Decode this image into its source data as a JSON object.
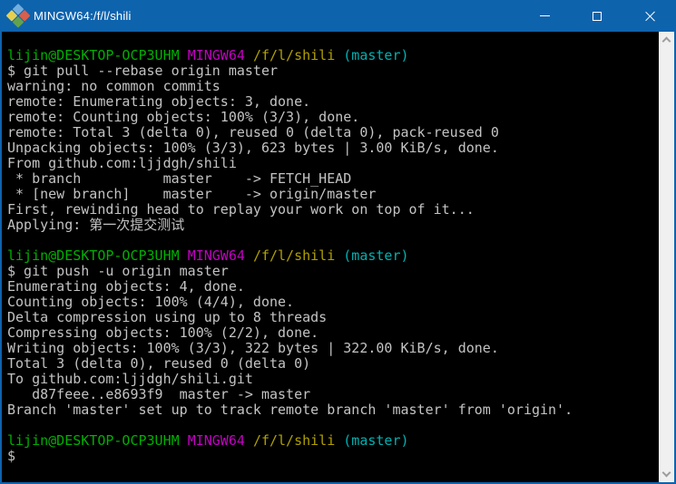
{
  "colors": {
    "titlebar_bg": "#0e63ad",
    "terminal_bg": "#000000",
    "fg": "#c3c3c3",
    "green": "#00b000",
    "magenta": "#c400c4",
    "yellow": "#b0a000",
    "cyan": "#00b2b2",
    "icon_blue": "#74aede",
    "icon_red": "#d75f4c",
    "icon_yellow": "#e6d04f",
    "icon_green": "#63a24c"
  },
  "titlebar": {
    "title": "MINGW64:/f/l/shili",
    "controls": [
      "minimize",
      "maximize",
      "close"
    ]
  },
  "terminal": {
    "lines": [
      {
        "segments": [
          {
            "color": "green",
            "text": "lijin@DESKTOP-OCP3UHM "
          },
          {
            "color": "magenta",
            "text": "MINGW64 "
          },
          {
            "color": "yellow",
            "text": "/f/l/shili "
          },
          {
            "color": "cyan",
            "text": "(master)"
          }
        ]
      },
      {
        "segments": [
          {
            "color": "fg",
            "text": "$ git pull --rebase origin master"
          }
        ]
      },
      {
        "segments": [
          {
            "color": "fg",
            "text": "warning: no common commits"
          }
        ]
      },
      {
        "segments": [
          {
            "color": "fg",
            "text": "remote: Enumerating objects: 3, done."
          }
        ]
      },
      {
        "segments": [
          {
            "color": "fg",
            "text": "remote: Counting objects: 100% (3/3), done."
          }
        ]
      },
      {
        "segments": [
          {
            "color": "fg",
            "text": "remote: Total 3 (delta 0), reused 0 (delta 0), pack-reused 0"
          }
        ]
      },
      {
        "segments": [
          {
            "color": "fg",
            "text": "Unpacking objects: 100% (3/3), 623 bytes | 3.00 KiB/s, done."
          }
        ]
      },
      {
        "segments": [
          {
            "color": "fg",
            "text": "From github.com:ljjdgh/shili"
          }
        ]
      },
      {
        "segments": [
          {
            "color": "fg",
            "text": " * branch          master    -> FETCH_HEAD"
          }
        ]
      },
      {
        "segments": [
          {
            "color": "fg",
            "text": " * [new branch]    master    -> origin/master"
          }
        ]
      },
      {
        "segments": [
          {
            "color": "fg",
            "text": "First, rewinding head to replay your work on top of it..."
          }
        ]
      },
      {
        "segments": [
          {
            "color": "fg",
            "text": "Applying: 第一次提交测试"
          }
        ]
      },
      {
        "segments": []
      },
      {
        "segments": [
          {
            "color": "green",
            "text": "lijin@DESKTOP-OCP3UHM "
          },
          {
            "color": "magenta",
            "text": "MINGW64 "
          },
          {
            "color": "yellow",
            "text": "/f/l/shili "
          },
          {
            "color": "cyan",
            "text": "(master)"
          }
        ]
      },
      {
        "segments": [
          {
            "color": "fg",
            "text": "$ git push -u origin master"
          }
        ]
      },
      {
        "segments": [
          {
            "color": "fg",
            "text": "Enumerating objects: 4, done."
          }
        ]
      },
      {
        "segments": [
          {
            "color": "fg",
            "text": "Counting objects: 100% (4/4), done."
          }
        ]
      },
      {
        "segments": [
          {
            "color": "fg",
            "text": "Delta compression using up to 8 threads"
          }
        ]
      },
      {
        "segments": [
          {
            "color": "fg",
            "text": "Compressing objects: 100% (2/2), done."
          }
        ]
      },
      {
        "segments": [
          {
            "color": "fg",
            "text": "Writing objects: 100% (3/3), 322 bytes | 322.00 KiB/s, done."
          }
        ]
      },
      {
        "segments": [
          {
            "color": "fg",
            "text": "Total 3 (delta 0), reused 0 (delta 0)"
          }
        ]
      },
      {
        "segments": [
          {
            "color": "fg",
            "text": "To github.com:ljjdgh/shili.git"
          }
        ]
      },
      {
        "segments": [
          {
            "color": "fg",
            "text": "   d87feee..e8693f9  master -> master"
          }
        ]
      },
      {
        "segments": [
          {
            "color": "fg",
            "text": "Branch 'master' set up to track remote branch 'master' from 'origin'."
          }
        ]
      },
      {
        "segments": []
      },
      {
        "segments": [
          {
            "color": "green",
            "text": "lijin@DESKTOP-OCP3UHM "
          },
          {
            "color": "magenta",
            "text": "MINGW64 "
          },
          {
            "color": "yellow",
            "text": "/f/l/shili "
          },
          {
            "color": "cyan",
            "text": "(master)"
          }
        ]
      },
      {
        "segments": [
          {
            "color": "fg",
            "text": "$"
          }
        ]
      }
    ]
  }
}
